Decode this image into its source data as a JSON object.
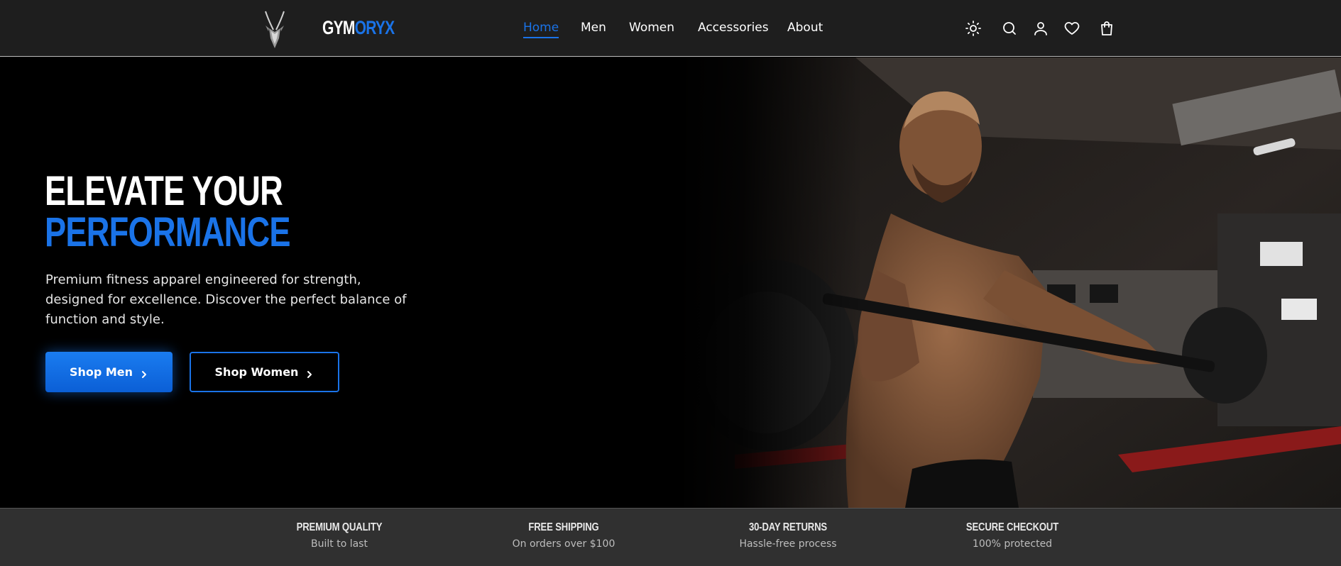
{
  "header": {
    "brand_part1": "GYM",
    "brand_part2": "ORYX",
    "nav": [
      {
        "label": "Home",
        "active": true
      },
      {
        "label": "Men",
        "active": false
      },
      {
        "label": "Women",
        "active": false
      },
      {
        "label": "Accessories",
        "active": false
      },
      {
        "label": "About",
        "active": false
      }
    ],
    "icons": [
      "sun-icon",
      "search-icon",
      "user-icon",
      "heart-icon",
      "bag-icon"
    ]
  },
  "hero": {
    "title_line1": "ELEVATE YOUR",
    "title_line2": "PERFORMANCE",
    "subtitle": "Premium fitness apparel engineered for strength, designed for excellence. Discover the perfect balance of function and style.",
    "primary_button": "Shop Men",
    "secondary_button": "Shop Women"
  },
  "features": [
    {
      "title": "PREMIUM QUALITY",
      "subtitle": "Built to last"
    },
    {
      "title": "FREE SHIPPING",
      "subtitle": "On orders over $100"
    },
    {
      "title": "30-DAY RETURNS",
      "subtitle": "Hassle-free process"
    },
    {
      "title": "SECURE CHECKOUT",
      "subtitle": "100% protected"
    }
  ],
  "colors": {
    "accent": "#1a73e8",
    "header_bg": "#1e1e1e",
    "features_bg": "#303030"
  }
}
